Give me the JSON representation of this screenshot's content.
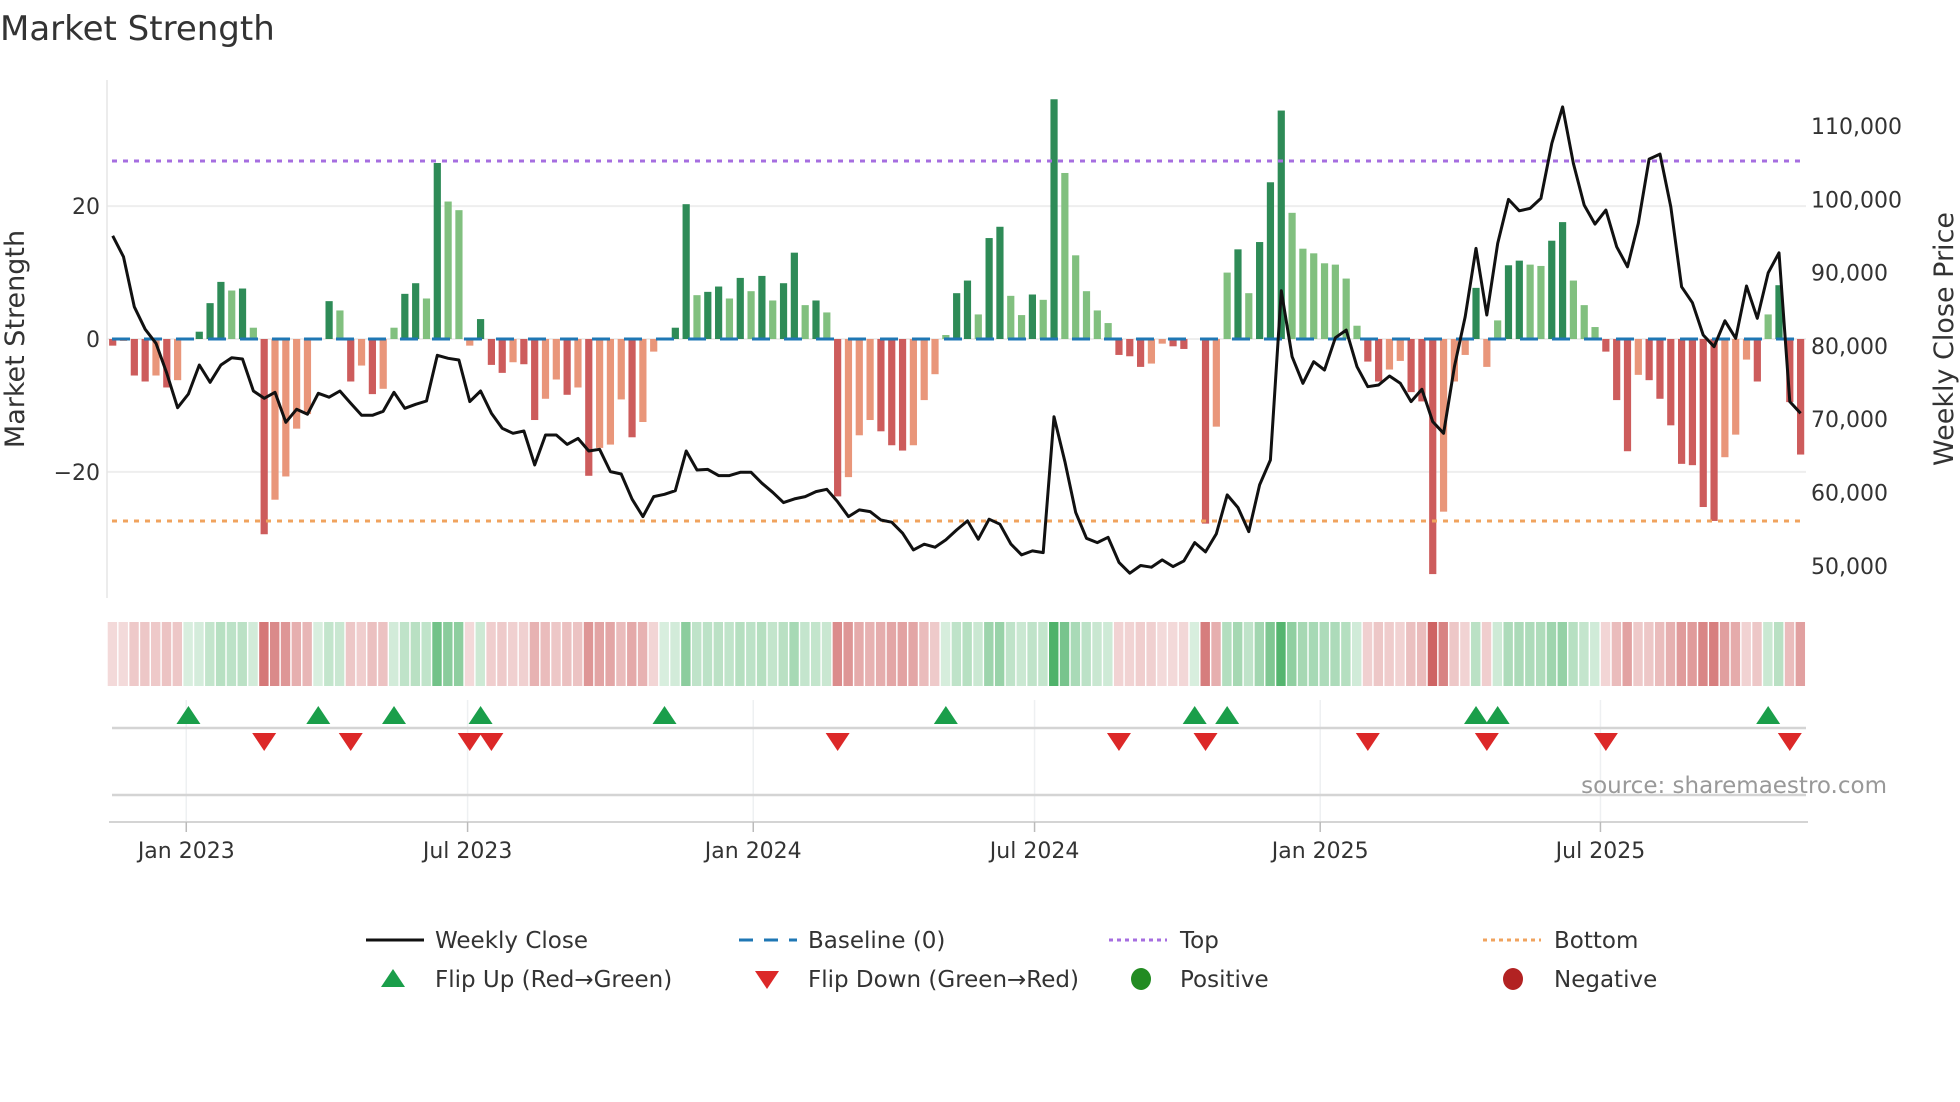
{
  "title": "Market Strength",
  "source": "source: sharemaestro.com",
  "colors": {
    "bar_pos_strong": "#2e8b57",
    "bar_pos_weak": "#81c07f",
    "bar_neg_strong": "#cd5c5c",
    "bar_neg_weak": "#e9967a",
    "baseline": "#1f77b4",
    "top": "#a66ee0",
    "bottom": "#f0a35e",
    "line": "#111111",
    "flip_up": "#1a9e4a",
    "flip_down": "#dc2828",
    "positive": "#228b22",
    "negative": "#b22222",
    "strip_pos": "60,170,90",
    "strip_neg": "200,80,80"
  },
  "legend": {
    "weekly_close": "Weekly Close",
    "baseline": "Baseline (0)",
    "top": "Top",
    "bottom": "Bottom",
    "flip_up": "Flip Up (Red→Green)",
    "flip_down": "Flip Down (Green→Red)",
    "positive": "Positive",
    "negative": "Negative"
  },
  "chart_data": {
    "type": "bar",
    "title": "Market Strength",
    "ylabel": "Market Strength",
    "y2label": "Weekly Close Price",
    "ylim": [
      -39,
      39
    ],
    "y2lim": [
      45600,
      116300
    ],
    "yticks": [
      {
        "value": 20,
        "label": "20"
      },
      {
        "value": 0,
        "label": "0"
      },
      {
        "value": -20,
        "label": "−20"
      }
    ],
    "y2ticks": [
      {
        "value": 110000,
        "label": "110,000"
      },
      {
        "value": 100000,
        "label": "100,000"
      },
      {
        "value": 90000,
        "label": "90,000"
      },
      {
        "value": 80000,
        "label": "80,000"
      },
      {
        "value": 70000,
        "label": "70,000"
      },
      {
        "value": 60000,
        "label": "60,000"
      },
      {
        "value": 50000,
        "label": "50,000"
      }
    ],
    "xticks": [
      {
        "week": 7.8,
        "label": "Jan 2023"
      },
      {
        "week": 33.8,
        "label": "Jul 2023"
      },
      {
        "week": 60.2,
        "label": "Jan 2024"
      },
      {
        "week": 86.2,
        "label": "Jul 2024"
      },
      {
        "week": 112.6,
        "label": "Jan 2025"
      },
      {
        "week": 138.5,
        "label": "Jul 2025"
      }
    ],
    "top_level": 26.8,
    "bottom_level": -27.4,
    "grid": true,
    "legend_placement": "bottom",
    "strength": [
      -1,
      -0.3,
      -5.5,
      -6.4,
      -5.5,
      -7.3,
      -6.2,
      0,
      1.1,
      5.4,
      8.6,
      7.3,
      7.6,
      1.7,
      -29.4,
      -24.2,
      -20.7,
      -13.5,
      -11.3,
      0,
      5.7,
      4.3,
      -6.4,
      -4,
      -8.3,
      -7.5,
      1.7,
      6.8,
      8.4,
      6.1,
      26.5,
      20.7,
      19.4,
      -1,
      3,
      -3.9,
      -5.1,
      -3.5,
      -3.8,
      -12.2,
      -9,
      -6.1,
      -8.4,
      -7.3,
      -20.6,
      -16.4,
      -15.9,
      -9.1,
      -14.8,
      -12.5,
      -1.9,
      0,
      1.7,
      20.3,
      6.6,
      7.1,
      7.9,
      6.1,
      9.2,
      7.2,
      9.5,
      5.8,
      8.4,
      13,
      5.1,
      5.8,
      4,
      -23.7,
      -20.8,
      -14.5,
      -12.2,
      -13.9,
      -16,
      -16.8,
      -16,
      -9.2,
      -5.3,
      0.6,
      6.9,
      8.8,
      3.7,
      15.2,
      16.9,
      6.5,
      3.6,
      6.7,
      5.9,
      36.1,
      25,
      12.6,
      7.2,
      4.3,
      2.4,
      -2.4,
      -2.6,
      -4.2,
      -3.7,
      -0.7,
      -1.1,
      -1.5,
      0,
      -27.8,
      -13.2,
      10,
      13.5,
      6.9,
      14.6,
      23.6,
      34.4,
      19,
      13.6,
      12.9,
      11.4,
      11.2,
      9.1,
      2,
      -3.4,
      -6.4,
      -4.6,
      -3.3,
      -8,
      -9.4,
      -35.4,
      -26,
      -6.4,
      -2.4,
      7.7,
      -4.2,
      2.8,
      11.1,
      11.8,
      11.2,
      11,
      14.8,
      17.6,
      8.8,
      5.1,
      1.8,
      -1.9,
      -9.2,
      -16.9,
      -5.4,
      -6.2,
      -9,
      -13,
      -18.8,
      -19,
      -25.3,
      -27.4,
      -17.8,
      -14.4,
      -3.1,
      -6.4,
      3.7,
      8.1,
      -9.5,
      -17.4
    ],
    "weekly_close": [
      95040,
      92170,
      85350,
      82270,
      80360,
      76270,
      71580,
      73450,
      77400,
      75040,
      77400,
      78400,
      78220,
      73850,
      72860,
      73680,
      69580,
      71360,
      70680,
      73540,
      73000,
      73850,
      72170,
      70540,
      70540,
      71080,
      73680,
      71490,
      72040,
      72490,
      78720,
      78310,
      78080,
      72400,
      73850,
      70820,
      68760,
      68080,
      68400,
      63760,
      67850,
      67850,
      66560,
      67380,
      65670,
      65900,
      62850,
      62530,
      59080,
      56710,
      59440,
      59760,
      60250,
      65670,
      63070,
      63150,
      62300,
      62300,
      62760,
      62760,
      61270,
      60030,
      58620,
      59120,
      59440,
      60120,
      60440,
      58750,
      56710,
      57620,
      57390,
      56250,
      55940,
      54440,
      52170,
      52940,
      52530,
      53530,
      54890,
      56120,
      53620,
      56350,
      55670,
      52990,
      51480,
      52030,
      51800,
      70350,
      64210,
      57290,
      53750,
      53160,
      53890,
      50460,
      48990,
      50030,
      49810,
      50800,
      49890,
      50670,
      53160,
      51890,
      54350,
      59670,
      57940,
      54660,
      61030,
      64440,
      87540,
      78540,
      74900,
      77850,
      76720,
      81130,
      82170,
      77170,
      74440,
      74670,
      75900,
      74900,
      72400,
      74090,
      69670,
      68080,
      77170,
      84000,
      93320,
      84220,
      94000,
      100000,
      98450,
      98770,
      100140,
      107640,
      112630,
      104910,
      99220,
      96630,
      98540,
      93540,
      90810,
      96730,
      105500,
      106180,
      98990,
      88080,
      85900,
      81490,
      79900,
      83440,
      81040,
      88180,
      83770,
      89990,
      92720,
      72400,
      70810
    ],
    "flip_up_weeks": [
      8,
      20,
      27,
      35,
      52,
      78,
      101,
      104,
      127,
      129,
      154
    ],
    "flip_down_weeks": [
      15,
      23,
      34,
      36,
      68,
      94,
      102,
      117,
      128,
      139,
      156
    ]
  }
}
